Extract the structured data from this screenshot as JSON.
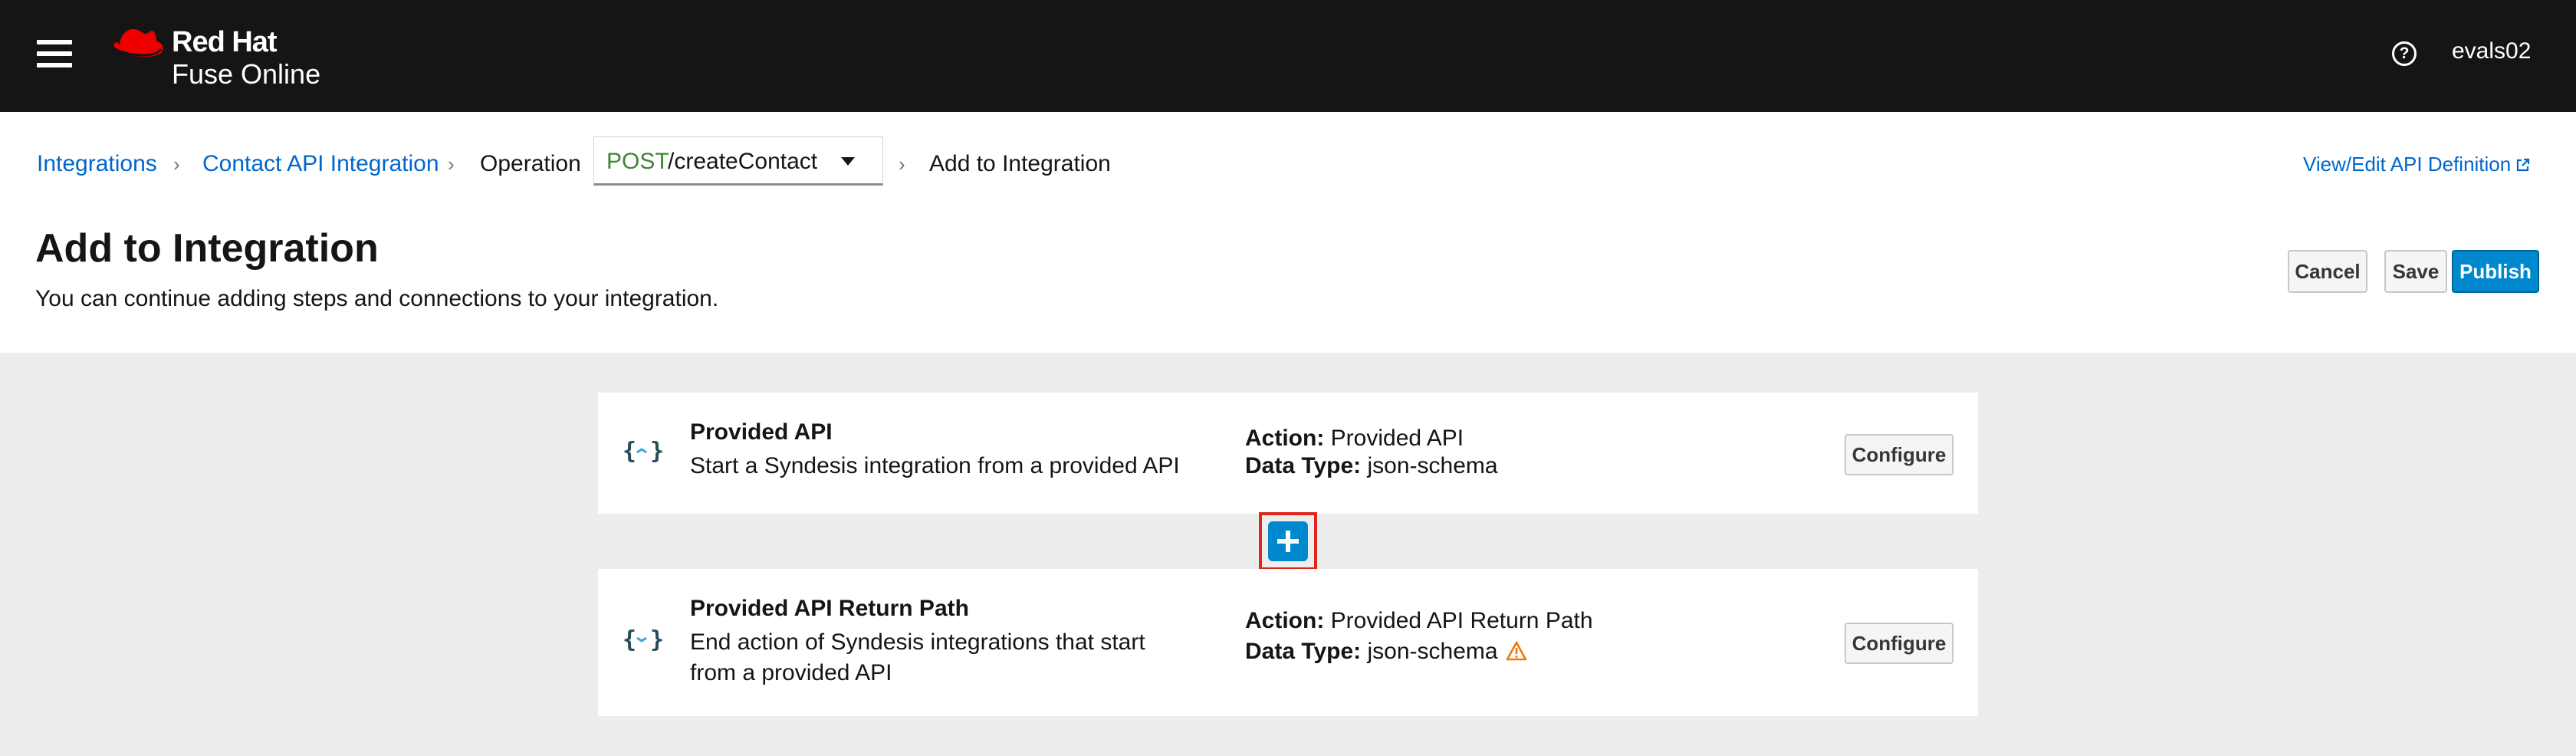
{
  "masthead": {
    "brand_line1": "Red Hat",
    "brand_line2": "Fuse Online",
    "user": "evals02",
    "menu_icon": "hamburger-icon",
    "help_icon": "question-circle-icon"
  },
  "breadcrumb": {
    "items": [
      "Integrations",
      "Contact API Integration"
    ],
    "operation_label": "Operation",
    "operation_method": "POST",
    "operation_path": "/createContact",
    "current": "Add to Integration"
  },
  "header": {
    "api_definition_link": "View/Edit API Definition",
    "title": "Add to Integration",
    "subtitle": "You can continue adding steps and connections to your integration.",
    "cancel": "Cancel",
    "save": "Save",
    "publish": "Publish"
  },
  "steps": [
    {
      "name": "Provided API",
      "description": "Start a Syndesis integration from a provided API",
      "action_label": "Action:",
      "action": "Provided API",
      "data_type_label": "Data Type:",
      "data_type": "json-schema",
      "configure": "Configure"
    },
    {
      "name": "Provided API Return Path",
      "description": "End action of Syndesis integrations that start from a provided API",
      "action_label": "Action:",
      "action": "Provided API Return Path",
      "data_type_label": "Data Type:",
      "data_type": "json-schema",
      "configure": "Configure",
      "warning": true
    }
  ],
  "colors": {
    "masthead_bg": "#151515",
    "brand_red": "#ee0000",
    "link": "#0066cc",
    "primary": "#0088ce",
    "post_method": "#3e8635",
    "warning": "#ec7a08",
    "highlight": "#e0271e",
    "flow_bg": "#ededed"
  }
}
